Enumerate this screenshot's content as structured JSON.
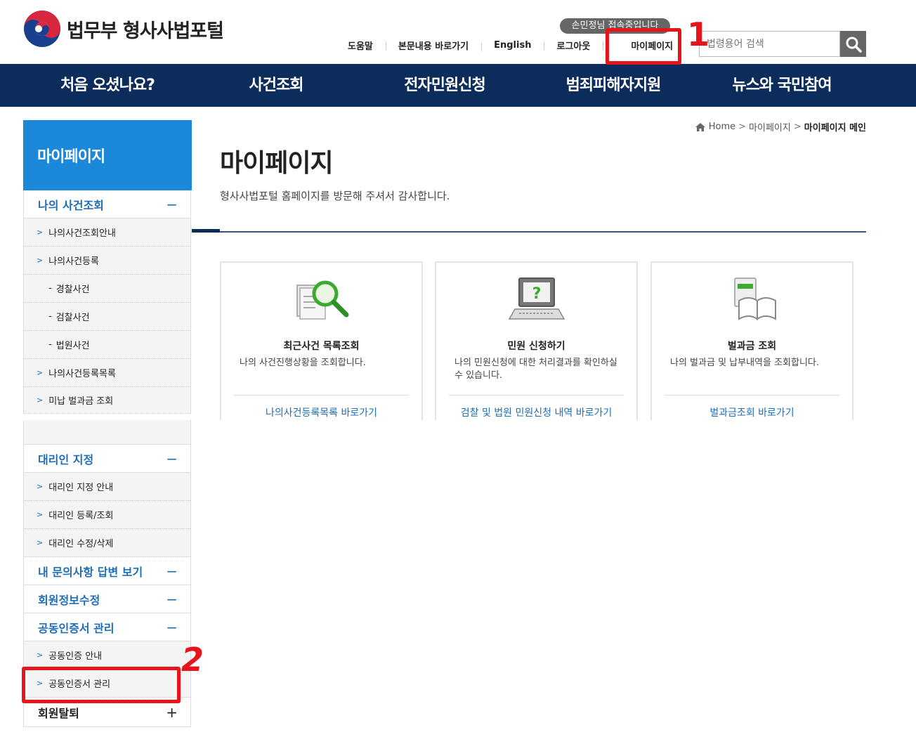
{
  "header": {
    "logo_text": "법무부 형사사법포털",
    "welcome": "손민정님 접속중입니다",
    "util_links": [
      "도움말",
      "본문내용 바로가기",
      "English",
      "로그아웃",
      "마이페이지"
    ],
    "search_placeholder": "법령용어 검색"
  },
  "nav": [
    "처음 오셨나요?",
    "사건조회",
    "전자민원신청",
    "범죄피해자지원",
    "뉴스와 국민참여"
  ],
  "sidebar": {
    "title": "마이페이지",
    "sec1": {
      "label": "나의 사건조회",
      "toggle": "−"
    },
    "sec1_items": [
      "나의사건조회안내",
      "나의사건등록"
    ],
    "sec1_subs": [
      "경찰사건",
      "검찰사건",
      "법원사건"
    ],
    "sec1_items2": [
      "나의사건등록목록",
      "미납 벌과금 조회"
    ],
    "sec2": {
      "label": "대리인 지정",
      "toggle": "−"
    },
    "sec2_items": [
      "대리인 지정 안내",
      "대리인 등록/조회",
      "대리인 수정/삭제"
    ],
    "sec3": {
      "label": "내 문의사항 답변 보기",
      "toggle": "−"
    },
    "sec4": {
      "label": "회원정보수정",
      "toggle": "−"
    },
    "sec5": {
      "label": "공동인증서 관리",
      "toggle": "−"
    },
    "sec5_items": [
      "공동인증 안내",
      "공동인증서 관리"
    ],
    "sec6": {
      "label": "회원탈퇴",
      "toggle": "+"
    }
  },
  "breadcrumb": {
    "home": "Home",
    "level1": "마이페이지",
    "current": "마이페이지 메인"
  },
  "main": {
    "title": "마이페이지",
    "desc": "형사사법포털 홈페이지를 방문해 주셔서 감사합니다."
  },
  "cards": [
    {
      "title": "최근사건 목록조회",
      "desc": "나의 사건진행상황을 조회합니다.",
      "link": "나의사건등록목록 바로가기",
      "icon": "magnifier-document-icon"
    },
    {
      "title": "민원 신청하기",
      "desc": "나의 민원신청에 대한 처리결과를 확인하실 수 있습니다.",
      "link": "검찰 및 법원 민원신청 내역 바로가기",
      "icon": "laptop-question-icon"
    },
    {
      "title": "벌과금 조회",
      "desc": "나의 벌과금 및 납부내역을 조회합니다.",
      "link": "벌과금조회 바로가기",
      "icon": "book-card-icon"
    }
  ],
  "annotations": {
    "mark1": "1",
    "mark2": "2"
  }
}
